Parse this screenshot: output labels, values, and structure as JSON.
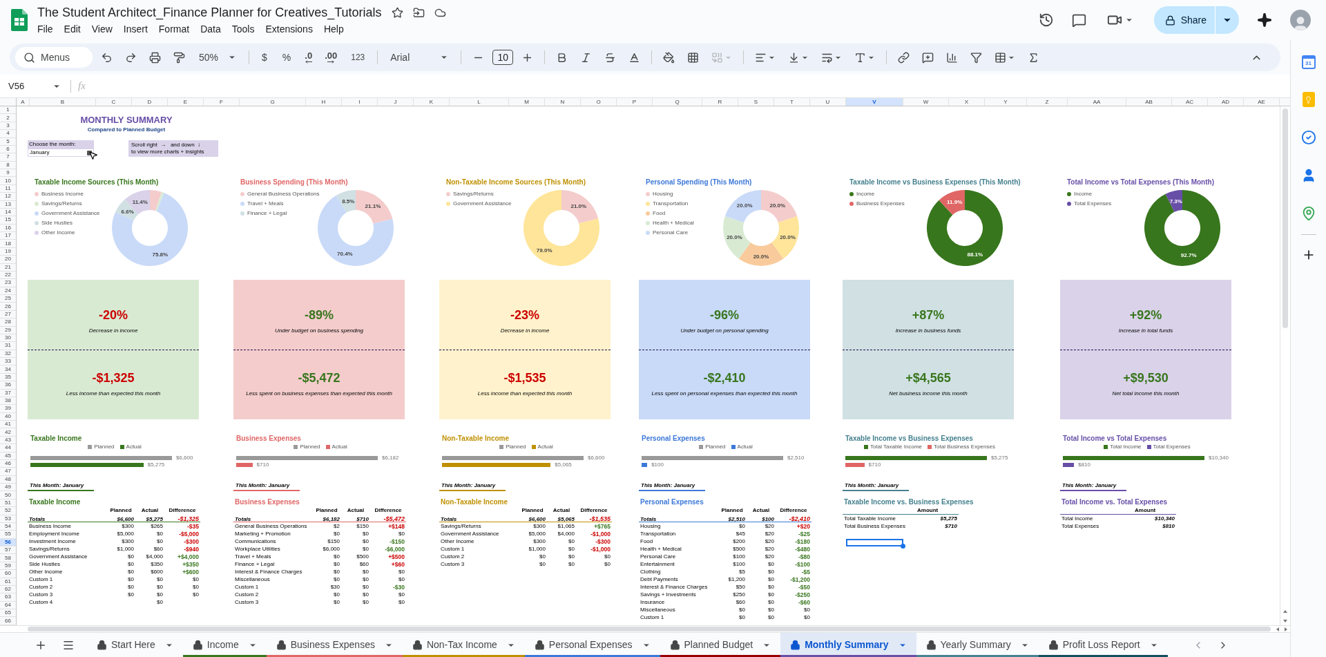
{
  "header": {
    "title": "The Student Architect_Finance Planner for Creatives_Tutorials",
    "menus": [
      "File",
      "Edit",
      "View",
      "Insert",
      "Format",
      "Data",
      "Tools",
      "Extensions",
      "Help"
    ],
    "share": "Share"
  },
  "toolbar": {
    "search": "Menus",
    "zoom": "50%",
    "currency": "$",
    "percent": "%",
    "decrease_decimal": ".0",
    "increase_decimal": ".00",
    "number_format": "123",
    "font": "Arial",
    "font_size": "10"
  },
  "formula_bar": {
    "cell": "V56",
    "fx": "fx"
  },
  "columns": [
    {
      "label": "A",
      "selected": false
    },
    {
      "label": "B",
      "selected": false
    },
    {
      "label": "C",
      "selected": false
    },
    {
      "label": "D",
      "selected": false
    },
    {
      "label": "E",
      "selected": false
    },
    {
      "label": "F",
      "selected": false
    },
    {
      "label": "G",
      "selected": false
    },
    {
      "label": "H",
      "selected": false
    },
    {
      "label": "I",
      "selected": false
    },
    {
      "label": "J",
      "selected": false
    },
    {
      "label": "K",
      "selected": false
    },
    {
      "label": "L",
      "selected": false
    },
    {
      "label": "M",
      "selected": false
    },
    {
      "label": "N",
      "selected": false
    },
    {
      "label": "O",
      "selected": false
    },
    {
      "label": "P",
      "selected": false
    },
    {
      "label": "Q",
      "selected": false
    },
    {
      "label": "R",
      "selected": false
    },
    {
      "label": "S",
      "selected": false
    },
    {
      "label": "T",
      "selected": false
    },
    {
      "label": "U",
      "selected": false
    },
    {
      "label": "V",
      "selected": true
    },
    {
      "label": "W",
      "selected": false
    },
    {
      "label": "X",
      "selected": false
    },
    {
      "label": "Y",
      "selected": false
    },
    {
      "label": "Z",
      "selected": false
    },
    {
      "label": "AA",
      "selected": false
    },
    {
      "label": "AB",
      "selected": false
    },
    {
      "label": "AC",
      "selected": false
    },
    {
      "label": "AD",
      "selected": false
    },
    {
      "label": "AE",
      "selected": false
    }
  ],
  "rows": [
    {
      "label": "1",
      "selected": false
    },
    {
      "label": "2",
      "selected": false
    },
    {
      "label": "3",
      "selected": false
    },
    {
      "label": "4",
      "selected": false
    },
    {
      "label": "5",
      "selected": false
    },
    {
      "label": "6",
      "selected": false
    },
    {
      "label": "7",
      "selected": false
    },
    {
      "label": "8",
      "selected": false
    },
    {
      "label": "9",
      "selected": false
    },
    {
      "label": "10",
      "selected": false
    },
    {
      "label": "11",
      "selected": false
    },
    {
      "label": "12",
      "selected": false
    },
    {
      "label": "13",
      "selected": false
    },
    {
      "label": "14",
      "selected": false
    },
    {
      "label": "15",
      "selected": false
    },
    {
      "label": "16",
      "selected": false
    },
    {
      "label": "17",
      "selected": false
    },
    {
      "label": "18",
      "selected": false
    },
    {
      "label": "19",
      "selected": false
    },
    {
      "label": "20",
      "selected": false
    },
    {
      "label": "21",
      "selected": false
    },
    {
      "label": "22",
      "selected": false
    },
    {
      "label": "23",
      "selected": false
    },
    {
      "label": "24",
      "selected": false
    },
    {
      "label": "25",
      "selected": false
    },
    {
      "label": "26",
      "selected": false
    },
    {
      "label": "27",
      "selected": false
    },
    {
      "label": "28",
      "selected": false
    },
    {
      "label": "29",
      "selected": false
    },
    {
      "label": "30",
      "selected": false
    },
    {
      "label": "31",
      "selected": false
    },
    {
      "label": "32",
      "selected": false
    },
    {
      "label": "33",
      "selected": false
    },
    {
      "label": "34",
      "selected": false
    },
    {
      "label": "35",
      "selected": false
    },
    {
      "label": "36",
      "selected": false
    },
    {
      "label": "37",
      "selected": false
    },
    {
      "label": "38",
      "selected": false
    },
    {
      "label": "39",
      "selected": false
    },
    {
      "label": "40",
      "selected": false
    },
    {
      "label": "41",
      "selected": false
    },
    {
      "label": "42",
      "selected": false
    },
    {
      "label": "43",
      "selected": false
    },
    {
      "label": "44",
      "selected": false
    },
    {
      "label": "45",
      "selected": false
    },
    {
      "label": "46",
      "selected": false
    },
    {
      "label": "47",
      "selected": false
    },
    {
      "label": "48",
      "selected": false
    },
    {
      "label": "49",
      "selected": false
    },
    {
      "label": "50",
      "selected": false
    },
    {
      "label": "51",
      "selected": false
    },
    {
      "label": "52",
      "selected": false
    },
    {
      "label": "53",
      "selected": false
    },
    {
      "label": "54",
      "selected": false
    },
    {
      "label": "55",
      "selected": false
    },
    {
      "label": "56",
      "selected": true
    },
    {
      "label": "57",
      "selected": false
    },
    {
      "label": "58",
      "selected": false
    },
    {
      "label": "59",
      "selected": false
    },
    {
      "label": "60",
      "selected": false
    },
    {
      "label": "61",
      "selected": false
    },
    {
      "label": "62",
      "selected": false
    },
    {
      "label": "63",
      "selected": false
    },
    {
      "label": "64",
      "selected": false
    },
    {
      "label": "65",
      "selected": false
    },
    {
      "label": "66",
      "selected": false
    }
  ],
  "summary": {
    "title": "MONTHLY SUMMARY",
    "subtitle": "Compared to Planned Budget"
  },
  "picker": {
    "label": "Choose the month:",
    "value": "January"
  },
  "note": {
    "lines": [
      "Scroll right  →   and down  ↓",
      "to view more charts + insights"
    ]
  },
  "panels": [
    {
      "color": "#38761d",
      "donut": {
        "chart_data": {
          "type": "donut",
          "title": "Taxable Income Sources (This Month)",
          "categories": [
            "Business Income",
            "Savings/Returns",
            "Government Assistance",
            "Side Hustles",
            "Other Income"
          ],
          "values": [
            5.0,
            1.1,
            75.8,
            6.6,
            11.4
          ],
          "colors": [
            "#f4cccc",
            "#d9ead3",
            "#c9daf8",
            "#d0e0e3",
            "#d9d2e9"
          ],
          "annotations": [
            {
              "x": "Government Assistance",
              "text": "75.8%"
            },
            {
              "x": "Side Hustles",
              "text": "6.6%"
            },
            {
              "x": "Other Income",
              "text": "11.4%"
            }
          ]
        }
      },
      "kpi": {
        "color": "#d9ead3",
        "percent": {
          "text": "-20%",
          "color": "#cc0000"
        },
        "percent_caption": "Decrease in income",
        "amount": {
          "text": "-$1,325",
          "color": "#cc0000"
        },
        "amount_caption": "Less income than expected this month"
      },
      "bar": {
        "chart_data": {
          "type": "bar",
          "orientation": "horizontal",
          "title": "Taxable Income",
          "legend": "top",
          "categories": [
            null
          ],
          "series": [
            {
              "name": "Planned",
              "color": "#999999",
              "values": [
                6600
              ],
              "value_labels": [
                "$6,600"
              ]
            },
            {
              "name": "Actual",
              "color": "#38761d",
              "values": [
                5275
              ],
              "value_labels": [
                "$5,275"
              ]
            }
          ]
        }
      },
      "table": {
        "kind": "detail",
        "month_label": "This Month: January",
        "title": "Taxable Income",
        "columns": [
          "Planned",
          "Actual",
          "Difference"
        ],
        "totals": {
          "label": "Totals",
          "planned": "$6,600",
          "actual": "$5,275",
          "difference": "-$1,325",
          "color": "#cc0000"
        },
        "rows": [
          {
            "label": "Business Income",
            "planned": "$300",
            "actual": "$265",
            "difference": "-$35",
            "color": "#cc0000"
          },
          {
            "label": "Employment Income",
            "planned": "$5,000",
            "actual": "$0",
            "difference": "-$5,000",
            "color": "#cc0000"
          },
          {
            "label": "Investment Income",
            "planned": "$300",
            "actual": "$0",
            "difference": "-$300",
            "color": "#cc0000"
          },
          {
            "label": "Savings/Returns",
            "planned": "$1,000",
            "actual": "$60",
            "difference": "-$940",
            "color": "#cc0000"
          },
          {
            "label": "Government Assistance",
            "planned": "$0",
            "actual": "$4,000",
            "difference": "+$4,000",
            "color": "#38761d"
          },
          {
            "label": "Side Hustles",
            "planned": "$0",
            "actual": "$350",
            "difference": "+$350",
            "color": "#38761d"
          },
          {
            "label": "Other Income",
            "planned": "$0",
            "actual": "$600",
            "difference": "+$600",
            "color": "#38761d"
          },
          {
            "label": "Custom 1",
            "planned": "$0",
            "actual": "$0",
            "difference": "$0"
          },
          {
            "label": "Custom 2",
            "planned": "$0",
            "actual": "$0",
            "difference": "$0"
          },
          {
            "label": "Custom 3",
            "planned": "$0",
            "actual": "$0",
            "difference": "$0"
          },
          {
            "label": "Custom 4",
            "actual": "$0"
          }
        ]
      }
    },
    {
      "color": "#e06666",
      "donut": {
        "chart_data": {
          "type": "donut",
          "title": "Business Spending (This Month)",
          "categories": [
            "General Business Operations",
            "Travel + Meals",
            "Finance + Legal"
          ],
          "values": [
            21.1,
            70.4,
            8.5
          ],
          "colors": [
            "#f4cccc",
            "#c9daf8",
            "#d0e0e3"
          ],
          "annotations": [
            {
              "x": "General Business Operations",
              "text": "21.1%"
            },
            {
              "x": "Travel + Meals",
              "text": "70.4%"
            },
            {
              "x": "Finance + Legal",
              "text": "8.5%"
            }
          ]
        }
      },
      "kpi": {
        "color": "#f4cccc",
        "percent": {
          "text": "-89%",
          "color": "#38761d"
        },
        "percent_caption": "Under budget on business spending",
        "amount": {
          "text": "-$5,472",
          "color": "#38761d"
        },
        "amount_caption": "Less spent on business expenses than expected this month"
      },
      "bar": {
        "chart_data": {
          "type": "bar",
          "orientation": "horizontal",
          "title": "Business Expenses",
          "legend": "top",
          "categories": [
            null
          ],
          "series": [
            {
              "name": "Planned",
              "color": "#999999",
              "values": [
                6182
              ],
              "value_labels": [
                "$6,182"
              ]
            },
            {
              "name": "Actual",
              "color": "#e06666",
              "values": [
                710
              ],
              "value_labels": [
                "$710"
              ]
            }
          ]
        }
      },
      "table": {
        "kind": "detail",
        "month_label": "This Month: January",
        "title": "Business Expenses",
        "columns": [
          "Planned",
          "Actual",
          "Difference"
        ],
        "totals": {
          "label": "Totals",
          "planned": "$6,182",
          "actual": "$710",
          "difference": "-$5,472",
          "color": "#cc0000"
        },
        "rows": [
          {
            "label": "General Business Operations",
            "planned": "$2",
            "actual": "$150",
            "difference": "+$148",
            "color": "#cc0000"
          },
          {
            "label": "Marketing + Promotion",
            "planned": "$0",
            "actual": "$0",
            "difference": "$0"
          },
          {
            "label": "Communications",
            "planned": "$150",
            "actual": "$0",
            "difference": "-$150",
            "color": "#38761d"
          },
          {
            "label": "Workplace Utilities",
            "planned": "$6,000",
            "actual": "$0",
            "difference": "-$6,000",
            "color": "#38761d"
          },
          {
            "label": "Travel + Meals",
            "planned": "$0",
            "actual": "$500",
            "difference": "+$500",
            "color": "#cc0000"
          },
          {
            "label": "Finance + Legal",
            "planned": "$0",
            "actual": "$60",
            "difference": "+$60",
            "color": "#cc0000"
          },
          {
            "label": "Interest & Finance Charges",
            "planned": "$0",
            "actual": "$0",
            "difference": "$0"
          },
          {
            "label": "Miscellaneous",
            "planned": "$0",
            "actual": "$0",
            "difference": "$0"
          },
          {
            "label": "Custom 1",
            "planned": "$30",
            "actual": "$0",
            "difference": "-$30",
            "color": "#38761d"
          },
          {
            "label": "Custom 2",
            "planned": "$0",
            "actual": "$0",
            "difference": "$0"
          },
          {
            "label": "Custom 3",
            "planned": "$0",
            "actual": "$0",
            "difference": "$0"
          }
        ]
      }
    },
    {
      "color": "#bf9000",
      "donut": {
        "chart_data": {
          "type": "donut",
          "title": "Non-Taxable Income Sources (This Month)",
          "categories": [
            "Savings/Returns",
            "Government Assistance"
          ],
          "values": [
            21.0,
            79.0
          ],
          "colors": [
            "#f4cccc",
            "#ffe599"
          ],
          "annotations": [
            {
              "x": "Savings/Returns",
              "text": "21.0%"
            },
            {
              "x": "Government Assistance",
              "text": "79.0%"
            }
          ]
        }
      },
      "kpi": {
        "color": "#fff2cc",
        "percent": {
          "text": "-23%",
          "color": "#cc0000"
        },
        "percent_caption": "Decrease in income",
        "amount": {
          "text": "-$1,535",
          "color": "#cc0000"
        },
        "amount_caption": "Less income than expected this month"
      },
      "bar": {
        "chart_data": {
          "type": "bar",
          "orientation": "horizontal",
          "title": "Non-Taxable Income",
          "legend": "top",
          "categories": [
            null
          ],
          "series": [
            {
              "name": "Planned",
              "color": "#999999",
              "values": [
                6600
              ],
              "value_labels": [
                "$6,600"
              ]
            },
            {
              "name": "Actual",
              "color": "#bf9000",
              "values": [
                5065
              ],
              "value_labels": [
                "$5,065"
              ]
            }
          ]
        }
      },
      "table": {
        "kind": "detail",
        "month_label": "This Month: January",
        "title": "Non-Taxable Income",
        "columns": [
          "Planned",
          "Actual",
          "Difference"
        ],
        "totals": {
          "label": "Totals",
          "planned": "$6,600",
          "actual": "$5,065",
          "difference": "-$1,535",
          "color": "#cc0000"
        },
        "rows": [
          {
            "label": "Savings/Returns",
            "planned": "$300",
            "actual": "$1,065",
            "difference": "+$765",
            "color": "#38761d"
          },
          {
            "label": "Government Assistance",
            "planned": "$5,000",
            "actual": "$4,000",
            "difference": "-$1,000",
            "color": "#cc0000"
          },
          {
            "label": "Other Income",
            "planned": "$300",
            "actual": "$0",
            "difference": "-$300",
            "color": "#cc0000"
          },
          {
            "label": "Custom 1",
            "planned": "$1,000",
            "actual": "$0",
            "difference": "-$1,000",
            "color": "#cc0000"
          },
          {
            "label": "Custom 2",
            "planned": "$0",
            "actual": "$0",
            "difference": "$0"
          },
          {
            "label": "Custom 3",
            "planned": "$0",
            "actual": "$0",
            "difference": "$0"
          }
        ]
      }
    },
    {
      "color": "#3c78d8",
      "donut": {
        "chart_data": {
          "type": "donut",
          "title": "Personal Spending (This Month)",
          "categories": [
            "Housing",
            "Transportation",
            "Food",
            "Health + Medical",
            "Personal Care"
          ],
          "values": [
            20.0,
            20.0,
            20.0,
            20.0,
            20.0
          ],
          "colors": [
            "#f4cccc",
            "#ffe599",
            "#f9cb9c",
            "#d9ead3",
            "#c9daf8"
          ],
          "annotations": [
            {
              "x": "Housing",
              "text": "20.0%"
            },
            {
              "x": "Transportation",
              "text": "20.0%"
            },
            {
              "x": "Food",
              "text": "20.0%"
            },
            {
              "x": "Health + Medical",
              "text": "20.0%"
            },
            {
              "x": "Personal Care",
              "text": "20.0%"
            }
          ]
        }
      },
      "kpi": {
        "color": "#c9daf8",
        "percent": {
          "text": "-96%",
          "color": "#38761d"
        },
        "percent_caption": "Under budget on personal spending",
        "amount": {
          "text": "-$2,410",
          "color": "#38761d"
        },
        "amount_caption": "Less spent on personal expenses than expected this month"
      },
      "bar": {
        "chart_data": {
          "type": "bar",
          "orientation": "horizontal",
          "title": "Personal Expenses",
          "legend": "top",
          "categories": [
            null
          ],
          "series": [
            {
              "name": "Planned",
              "color": "#999999",
              "values": [
                2510
              ],
              "value_labels": [
                "$2,510"
              ]
            },
            {
              "name": "Actual",
              "color": "#3c78d8",
              "values": [
                100
              ],
              "value_labels": [
                "$100"
              ]
            }
          ]
        }
      },
      "table": {
        "kind": "detail",
        "month_label": "This Month: January",
        "title": "Personal Expenses",
        "columns": [
          "Planned",
          "Actual",
          "Difference"
        ],
        "totals": {
          "label": "Totals",
          "planned": "$2,510",
          "actual": "$100",
          "difference": "-$2,410",
          "color": "#cc0000"
        },
        "rows": [
          {
            "label": "Housing",
            "planned": "$0",
            "actual": "$20",
            "difference": "+$20",
            "color": "#cc0000"
          },
          {
            "label": "Transportation",
            "planned": "$45",
            "actual": "$20",
            "difference": "-$25",
            "color": "#38761d"
          },
          {
            "label": "Food",
            "planned": "$200",
            "actual": "$20",
            "difference": "-$180",
            "color": "#38761d"
          },
          {
            "label": "Health + Medical",
            "planned": "$500",
            "actual": "$20",
            "difference": "-$480",
            "color": "#38761d"
          },
          {
            "label": "Personal Care",
            "planned": "$100",
            "actual": "$20",
            "difference": "-$80",
            "color": "#38761d"
          },
          {
            "label": "Entertainment",
            "planned": "$100",
            "actual": "$0",
            "difference": "-$100",
            "color": "#38761d"
          },
          {
            "label": "Clothing",
            "planned": "$5",
            "actual": "$0",
            "difference": "-$5",
            "color": "#38761d"
          },
          {
            "label": "Debt Payments",
            "planned": "$1,200",
            "actual": "$0",
            "difference": "-$1,200",
            "color": "#38761d"
          },
          {
            "label": "Interest & Finance Charges",
            "planned": "$50",
            "actual": "$0",
            "difference": "-$50",
            "color": "#38761d"
          },
          {
            "label": "Savings + Investments",
            "planned": "$250",
            "actual": "$0",
            "difference": "-$250",
            "color": "#38761d"
          },
          {
            "label": "Insurance",
            "planned": "$60",
            "actual": "$0",
            "difference": "-$60",
            "color": "#38761d"
          },
          {
            "label": "Miscellaneous",
            "planned": "$0",
            "actual": "$0",
            "difference": "$0"
          },
          {
            "label": "Custom 1",
            "planned": "$0",
            "actual": "$0",
            "difference": "$0"
          }
        ]
      }
    },
    {
      "color": "#45818e",
      "donut": {
        "chart_data": {
          "type": "donut",
          "title": "Taxable Income vs Business Expenses (This Month)",
          "categories": [
            "Income",
            "Business Expenses"
          ],
          "values": [
            88.1,
            11.9
          ],
          "colors": [
            "#38761d",
            "#e06666"
          ],
          "annotations": [
            {
              "x": "Income",
              "text": "88.1%"
            },
            {
              "x": "Business Expenses",
              "text": "11.9%"
            }
          ]
        }
      },
      "kpi": {
        "color": "#d0e0e3",
        "percent": {
          "text": "+87%",
          "color": "#38761d"
        },
        "percent_caption": "Increase in business funds",
        "amount": {
          "text": "+$4,565",
          "color": "#38761d"
        },
        "amount_caption": "Net business income this month"
      },
      "bar": {
        "chart_data": {
          "type": "bar",
          "orientation": "horizontal",
          "title": "Taxable Income vs Business Expenses",
          "legend": "top",
          "categories": [
            null
          ],
          "series": [
            {
              "name": "Total Taxable Income",
              "color": "#38761d",
              "values": [
                5275
              ],
              "value_labels": [
                "$5,275"
              ]
            },
            {
              "name": "Total Business Expenses",
              "color": "#e06666",
              "values": [
                710
              ],
              "value_labels": [
                "$710"
              ]
            }
          ]
        }
      },
      "table": {
        "kind": "summary",
        "month_label": "This Month: January",
        "title": "Taxable Income vs. Business Expenses",
        "columns": [
          "Amount"
        ],
        "rows": [
          {
            "label": "Total Taxable Income",
            "amount": "$5,275"
          },
          {
            "label": "Total Business Expenses",
            "amount": "$710"
          }
        ]
      }
    },
    {
      "color": "#674ea7",
      "donut": {
        "chart_data": {
          "type": "donut",
          "title": "Total Income vs Total Expenses (This Month)",
          "categories": [
            "Income",
            "Total Expenses"
          ],
          "values": [
            92.7,
            7.3
          ],
          "colors": [
            "#38761d",
            "#674ea7"
          ],
          "annotations": [
            {
              "x": "Income",
              "text": "92.7%"
            },
            {
              "x": "Total Expenses",
              "text": "7.3%"
            }
          ]
        }
      },
      "kpi": {
        "color": "#d9d2e9",
        "percent": {
          "text": "+92%",
          "color": "#38761d"
        },
        "percent_caption": "Increase in total funds",
        "amount": {
          "text": "+$9,530",
          "color": "#38761d"
        },
        "amount_caption": "Net total income this month"
      },
      "bar": {
        "chart_data": {
          "type": "bar",
          "orientation": "horizontal",
          "title": "Total Income vs Total Expenses",
          "legend": "top",
          "categories": [
            null
          ],
          "series": [
            {
              "name": "Total Income",
              "color": "#38761d",
              "values": [
                10340
              ],
              "value_labels": [
                "$10,340"
              ]
            },
            {
              "name": "Total Expenses",
              "color": "#674ea7",
              "values": [
                810
              ],
              "value_labels": [
                "$810"
              ]
            }
          ]
        }
      },
      "table": {
        "kind": "summary",
        "month_label": "This Month: January",
        "title": "Total Income vs. Total Expenses",
        "columns": [
          "Amount"
        ],
        "rows": [
          {
            "label": "Total Income",
            "amount": "$10,340"
          },
          {
            "label": "Total Expenses",
            "amount": "$810"
          }
        ]
      }
    }
  ],
  "tabs": [
    {
      "label": "Start Here",
      "selected": false
    },
    {
      "label": "Income",
      "selected": false,
      "color": "#38761d"
    },
    {
      "label": "Business Expenses",
      "selected": false,
      "color": "#e06666"
    },
    {
      "label": "Non-Tax Income",
      "selected": false,
      "color": "#bf9000"
    },
    {
      "label": "Personal Expenses",
      "selected": false,
      "color": "#3c78d8"
    },
    {
      "label": "Planned Budget",
      "selected": false,
      "color": "#990000"
    },
    {
      "label": "Monthly Summary",
      "selected": true,
      "color": "#674ea7"
    },
    {
      "label": "Yearly Summary",
      "selected": false,
      "color": "#45818e"
    },
    {
      "label": "Profit Loss Report",
      "selected": false,
      "color": "#134f5c"
    }
  ],
  "side_panel": {
    "calendar_day": "31"
  }
}
